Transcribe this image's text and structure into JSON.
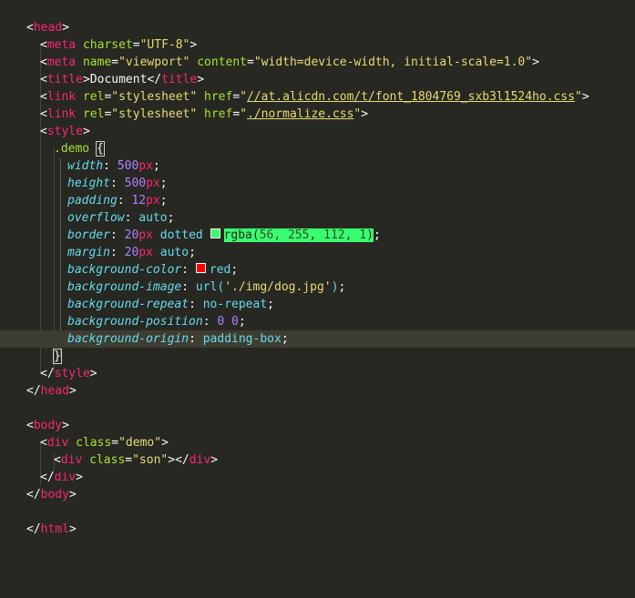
{
  "editor": {
    "theme_colors": {
      "background": "#272822",
      "tag": "#f92672",
      "attribute": "#a6e22e",
      "string": "#e6db74",
      "property": "#66d9ef",
      "number": "#ae81ff",
      "highlight_green": "#38ff70",
      "swatch_red": "#ff0000"
    },
    "lines": {
      "l1": {
        "open": "<",
        "tag": "head",
        "close": ">"
      },
      "l2": {
        "open": "<",
        "tag": "meta",
        "attr1": "charset",
        "eq1": "=",
        "val1": "\"UTF-8\"",
        "close": ">"
      },
      "l3": {
        "open": "<",
        "tag": "meta",
        "attr1": "name",
        "eq1": "=",
        "val1": "\"viewport\"",
        "attr2": "content",
        "eq2": "=",
        "val2": "\"width=device-width, initial-scale=1.0\"",
        "close": ">"
      },
      "l4": {
        "open": "<",
        "tag": "title",
        "close1": ">",
        "text": "Document",
        "open2": "</",
        "tag2": "title",
        "close2": ">"
      },
      "l5": {
        "open": "<",
        "tag": "link",
        "attr1": "rel",
        "eq1": "=",
        "val1": "\"stylesheet\"",
        "attr2": "href",
        "eq2": "=",
        "q1": "\"",
        "url": "//at.alicdn.com/t/font_1804769_sxb3l1524ho.css",
        "q2": "\"",
        "close": ">"
      },
      "l6": {
        "open": "<",
        "tag": "link",
        "attr1": "rel",
        "eq1": "=",
        "val1": "\"stylesheet\"",
        "attr2": "href",
        "eq2": "=",
        "q1": "\"",
        "url": "./normalize.css",
        "q2": "\"",
        "close": ">"
      },
      "l7": {
        "open": "<",
        "tag": "style",
        "close": ">"
      },
      "l8": {
        "selector": ".demo",
        "brace": "{"
      },
      "l9": {
        "prop": "width",
        "colon": ": ",
        "num": "500",
        "unit": "px",
        "semi": ";"
      },
      "l10": {
        "prop": "height",
        "colon": ": ",
        "num": "500",
        "unit": "px",
        "semi": ";"
      },
      "l11": {
        "prop": "padding",
        "colon": ": ",
        "num": "12",
        "unit": "px",
        "semi": ";"
      },
      "l12": {
        "prop": "overflow",
        "colon": ": ",
        "value": "auto",
        "semi": ";"
      },
      "l13": {
        "prop": "border",
        "colon": ": ",
        "num": "20",
        "unit": "px",
        "value": " dotted ",
        "fn": "rgba(",
        "n1": "56",
        "c1": ", ",
        "n2": "255",
        "c2": ", ",
        "n3": "112",
        "c3": ", ",
        "n4": "1",
        "fnclose": ")",
        "semi": ";"
      },
      "l14": {
        "prop": "margin",
        "colon": ": ",
        "num": "20",
        "unit": "px",
        "value": " auto",
        "semi": ";"
      },
      "l15": {
        "prop": "background-color",
        "colon": ": ",
        "value": "red",
        "semi": ";"
      },
      "l16": {
        "prop": "background-image",
        "colon": ": ",
        "fn": "url(",
        "str": "'./img/dog.jpg'",
        "fnclose": ")",
        "semi": ";"
      },
      "l17": {
        "prop": "background-repeat",
        "colon": ": ",
        "value": "no-repeat",
        "semi": ";"
      },
      "l18": {
        "prop": "background-position",
        "colon": ": ",
        "n1": "0",
        "sp": " ",
        "n2": "0",
        "semi": ";"
      },
      "l19": {
        "prop": "background-origin",
        "colon": ": ",
        "value": "padding-box",
        "semi": ";"
      },
      "l20": {
        "brace": "}"
      },
      "l21": {
        "open": "</",
        "tag": "style",
        "close": ">"
      },
      "l22": {
        "open": "</",
        "tag": "head",
        "close": ">"
      },
      "l24": {
        "open": "<",
        "tag": "body",
        "close": ">"
      },
      "l25": {
        "open": "<",
        "tag": "div",
        "attr1": "class",
        "eq1": "=",
        "val1": "\"demo\"",
        "close": ">"
      },
      "l26": {
        "open": "<",
        "tag": "div",
        "attr1": "class",
        "eq1": "=",
        "val1": "\"son\"",
        "close1": ">",
        "open2": "</",
        "tag2": "div",
        "close2": ">"
      },
      "l27": {
        "open": "</",
        "tag": "div",
        "close": ">"
      },
      "l28": {
        "open": "</",
        "tag": "body",
        "close": ">"
      },
      "l30": {
        "open": "</",
        "tag": "html",
        "close": ">"
      }
    }
  }
}
